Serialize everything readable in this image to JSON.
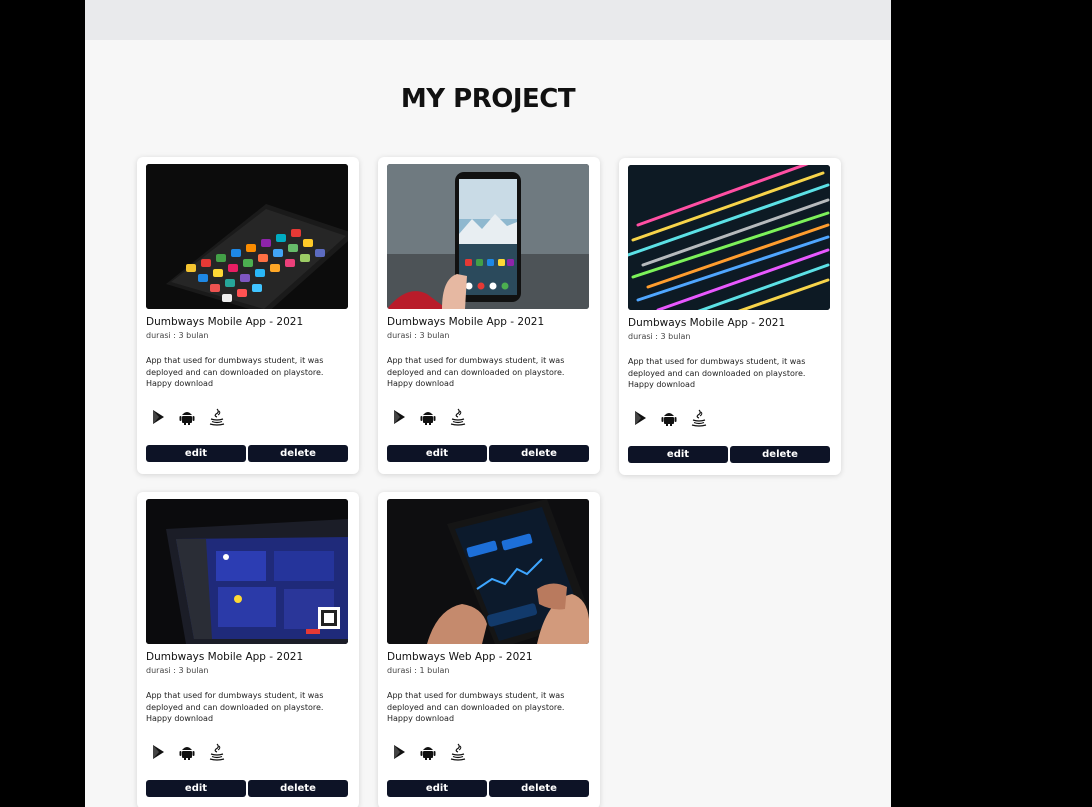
{
  "header": {
    "title": "MY PROJECT"
  },
  "projects": [
    {
      "title": "Dumbways Mobile App - 2021",
      "duration": "durasi : 3 bulan",
      "description": "App that used for dumbways student, it was deployed and can downloaded on playstore. Happy download",
      "image": "phone-on-dark-table",
      "edit_label": "edit",
      "delete_label": "delete",
      "tech_icons": [
        "google-play-icon",
        "android-icon",
        "java-icon"
      ]
    },
    {
      "title": "Dumbways Mobile App - 2021",
      "duration": "durasi : 3 bulan",
      "description": "App that used for dumbways student, it was deployed and can downloaded on playstore. Happy download",
      "image": "hand-holding-phone-mountains",
      "edit_label": "edit",
      "delete_label": "delete",
      "tech_icons": [
        "google-play-icon",
        "android-icon",
        "java-icon"
      ]
    },
    {
      "title": "Dumbways Mobile App - 2021",
      "duration": "durasi : 3 bulan",
      "description": "App that used for dumbways student, it was deployed and can downloaded on playstore. Happy download",
      "image": "colorful-code-screen",
      "edit_label": "edit",
      "delete_label": "delete",
      "tech_icons": [
        "google-play-icon",
        "android-icon",
        "java-icon"
      ]
    },
    {
      "title": "Dumbways Mobile App - 2021",
      "duration": "durasi : 3 bulan",
      "description": "App that used for dumbways student, it was deployed and can downloaded on playstore. Happy download",
      "image": "crypto-dashboard-laptop",
      "edit_label": "edit",
      "delete_label": "delete",
      "tech_icons": [
        "google-play-icon",
        "android-icon",
        "java-icon"
      ]
    },
    {
      "title": "Dumbways Web App - 2021",
      "duration": "durasi : 1 bulan",
      "description": "App that used for dumbways student, it was deployed and can downloaded on playstore. Happy download",
      "image": "hands-holding-trading-app",
      "edit_label": "edit",
      "delete_label": "delete",
      "tech_icons": [
        "google-play-icon",
        "android-icon",
        "java-icon"
      ]
    }
  ],
  "colors": {
    "button_bg": "#0d1326",
    "page_bg": "#f7f7f7",
    "topbar_bg": "#e9eaec"
  }
}
